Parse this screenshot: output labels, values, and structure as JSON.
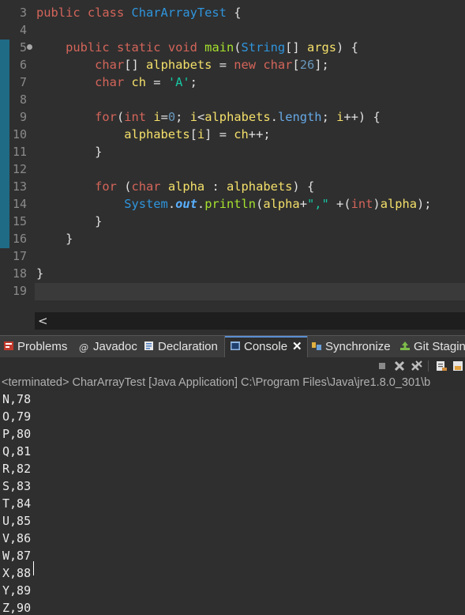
{
  "editor": {
    "lines": [
      {
        "num": "3",
        "tokens": [
          [
            "kw",
            "public "
          ],
          [
            "kw",
            "class "
          ],
          [
            "cls",
            "CharArrayTest"
          ],
          [
            "op",
            " {"
          ]
        ]
      },
      {
        "num": "4",
        "tokens": []
      },
      {
        "num": "5",
        "fold": true,
        "tokens": [
          [
            "op",
            "    "
          ],
          [
            "kw",
            "public "
          ],
          [
            "kw",
            "static "
          ],
          [
            "kw",
            "void "
          ],
          [
            "mth",
            "main"
          ],
          [
            "op",
            "("
          ],
          [
            "cls",
            "String"
          ],
          [
            "op",
            "[] "
          ],
          [
            "var",
            "args"
          ],
          [
            "op",
            ") {"
          ]
        ]
      },
      {
        "num": "6",
        "tokens": [
          [
            "op",
            "        "
          ],
          [
            "ty",
            "char"
          ],
          [
            "op",
            "[] "
          ],
          [
            "var",
            "alphabets"
          ],
          [
            "op",
            " = "
          ],
          [
            "kw",
            "new "
          ],
          [
            "ty",
            "char"
          ],
          [
            "op",
            "["
          ],
          [
            "num",
            "26"
          ],
          [
            "op",
            "];"
          ]
        ]
      },
      {
        "num": "7",
        "tokens": [
          [
            "op",
            "        "
          ],
          [
            "ty",
            "char "
          ],
          [
            "var",
            "ch"
          ],
          [
            "op",
            " = "
          ],
          [
            "str",
            "'A'"
          ],
          [
            "op",
            ";"
          ]
        ]
      },
      {
        "num": "8",
        "tokens": []
      },
      {
        "num": "9",
        "tokens": [
          [
            "op",
            "        "
          ],
          [
            "kw",
            "for"
          ],
          [
            "op",
            "("
          ],
          [
            "ty",
            "int "
          ],
          [
            "var",
            "i"
          ],
          [
            "op",
            "="
          ],
          [
            "num",
            "0"
          ],
          [
            "op",
            "; "
          ],
          [
            "var",
            "i"
          ],
          [
            "op",
            "<"
          ],
          [
            "var",
            "alphabets"
          ],
          [
            "op",
            "."
          ],
          [
            "fld",
            "length"
          ],
          [
            "op",
            "; "
          ],
          [
            "var",
            "i"
          ],
          [
            "op",
            "++) {"
          ]
        ]
      },
      {
        "num": "10",
        "tokens": [
          [
            "op",
            "            "
          ],
          [
            "var",
            "alphabets"
          ],
          [
            "op",
            "["
          ],
          [
            "var",
            "i"
          ],
          [
            "op",
            "] = "
          ],
          [
            "var",
            "ch"
          ],
          [
            "op",
            "++;"
          ]
        ]
      },
      {
        "num": "11",
        "tokens": [
          [
            "op",
            "        }"
          ]
        ]
      },
      {
        "num": "12",
        "tokens": []
      },
      {
        "num": "13",
        "tokens": [
          [
            "op",
            "        "
          ],
          [
            "kw",
            "for "
          ],
          [
            "op",
            "("
          ],
          [
            "ty",
            "char "
          ],
          [
            "var",
            "alpha"
          ],
          [
            "op",
            " : "
          ],
          [
            "var",
            "alphabets"
          ],
          [
            "op",
            ") {"
          ]
        ]
      },
      {
        "num": "14",
        "tokens": [
          [
            "op",
            "            "
          ],
          [
            "scls",
            "System"
          ],
          [
            "op",
            "."
          ],
          [
            "sfld",
            "out"
          ],
          [
            "op",
            "."
          ],
          [
            "mth",
            "println"
          ],
          [
            "op",
            "("
          ],
          [
            "var",
            "alpha"
          ],
          [
            "op",
            "+"
          ],
          [
            "str",
            "\",\""
          ],
          [
            "op",
            " +("
          ],
          [
            "ty",
            "int"
          ],
          [
            "op",
            ")"
          ],
          [
            "var",
            "alpha"
          ],
          [
            "op",
            ");"
          ]
        ]
      },
      {
        "num": "15",
        "tokens": [
          [
            "op",
            "        }"
          ]
        ]
      },
      {
        "num": "16",
        "tokens": [
          [
            "op",
            "    }"
          ]
        ]
      },
      {
        "num": "17",
        "tokens": []
      },
      {
        "num": "18",
        "tokens": [
          [
            "op",
            "}"
          ]
        ]
      },
      {
        "num": "19",
        "tokens": []
      }
    ],
    "hscroll_left": "<"
  },
  "tabs": [
    {
      "label": "Problems",
      "icon": "problems-icon",
      "active": false
    },
    {
      "label": "Javadoc",
      "icon": "javadoc-icon",
      "active": false
    },
    {
      "label": "Declaration",
      "icon": "declaration-icon",
      "active": false
    },
    {
      "label": "Console",
      "icon": "console-icon",
      "active": true
    },
    {
      "label": "Synchronize",
      "icon": "synchronize-icon",
      "active": false
    },
    {
      "label": "Git Stagin",
      "icon": "git-staging-icon",
      "active": false
    }
  ],
  "console": {
    "toolbar_icons": [
      "terminate-icon",
      "remove-launch-icon",
      "remove-all-terminated-icon",
      "clear-console-icon",
      "scroll-lock-icon"
    ],
    "status": "<terminated> CharArrayTest [Java Application] C:\\Program Files\\Java\\jre1.8.0_301\\b",
    "output": [
      "N,78",
      "O,79",
      "P,80",
      "Q,81",
      "R,82",
      "S,83",
      "T,84",
      "U,85",
      "V,86",
      "W,87",
      "X,88",
      "Y,89",
      "Z,90"
    ]
  },
  "colors": {
    "background": "#2f2f2f",
    "keyword": "#d4655a",
    "class": "#2f95dd",
    "method": "#a6e22e",
    "variable": "#f4e06a",
    "string": "#17c6a3",
    "active_tab_accent": "#5b8fd1"
  }
}
